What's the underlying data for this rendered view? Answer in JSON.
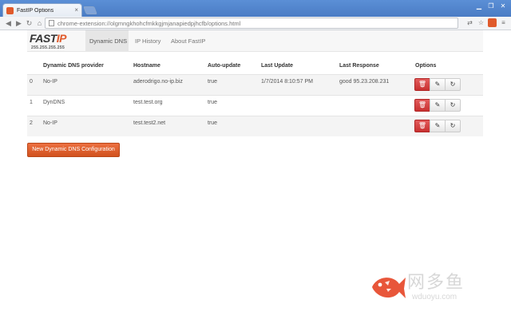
{
  "browser": {
    "tab_title": "FastIP Options",
    "tab_close": "×",
    "url": "chrome-extension://olgmngkhohcfmkkgjmjanapiedpjhcfb/options.html"
  },
  "app": {
    "logo_text": "FAST",
    "logo_accent": "IP",
    "logo_subtext": "255.255.255.255",
    "nav": [
      {
        "label": "Dynamic DNS",
        "active": true
      },
      {
        "label": "IP History",
        "active": false
      },
      {
        "label": "About FastIP",
        "active": false
      }
    ],
    "brand_color": "#e05a2b"
  },
  "table": {
    "headers": [
      "",
      "Dynamic DNS provider",
      "Hostname",
      "Auto-update",
      "Last Update",
      "Last Response",
      "Options"
    ],
    "rows": [
      {
        "index": "0",
        "provider": "No-IP",
        "hostname": "aderodrigo.no-ip.biz",
        "auto_update": "true",
        "last_update": "1/7/2014 8:10:57 PM",
        "last_response": "good 95.23.208.231"
      },
      {
        "index": "1",
        "provider": "DynDNS",
        "hostname": "test.test.org",
        "auto_update": "true",
        "last_update": "",
        "last_response": ""
      },
      {
        "index": "2",
        "provider": "No-IP",
        "hostname": "test.test2.net",
        "auto_update": "true",
        "last_update": "",
        "last_response": ""
      }
    ]
  },
  "actions": {
    "new_config_label": "New Dynamic DNS Configuration"
  },
  "watermark": {
    "cn_text": "网多鱼",
    "en_text": "wduoyu.com"
  }
}
